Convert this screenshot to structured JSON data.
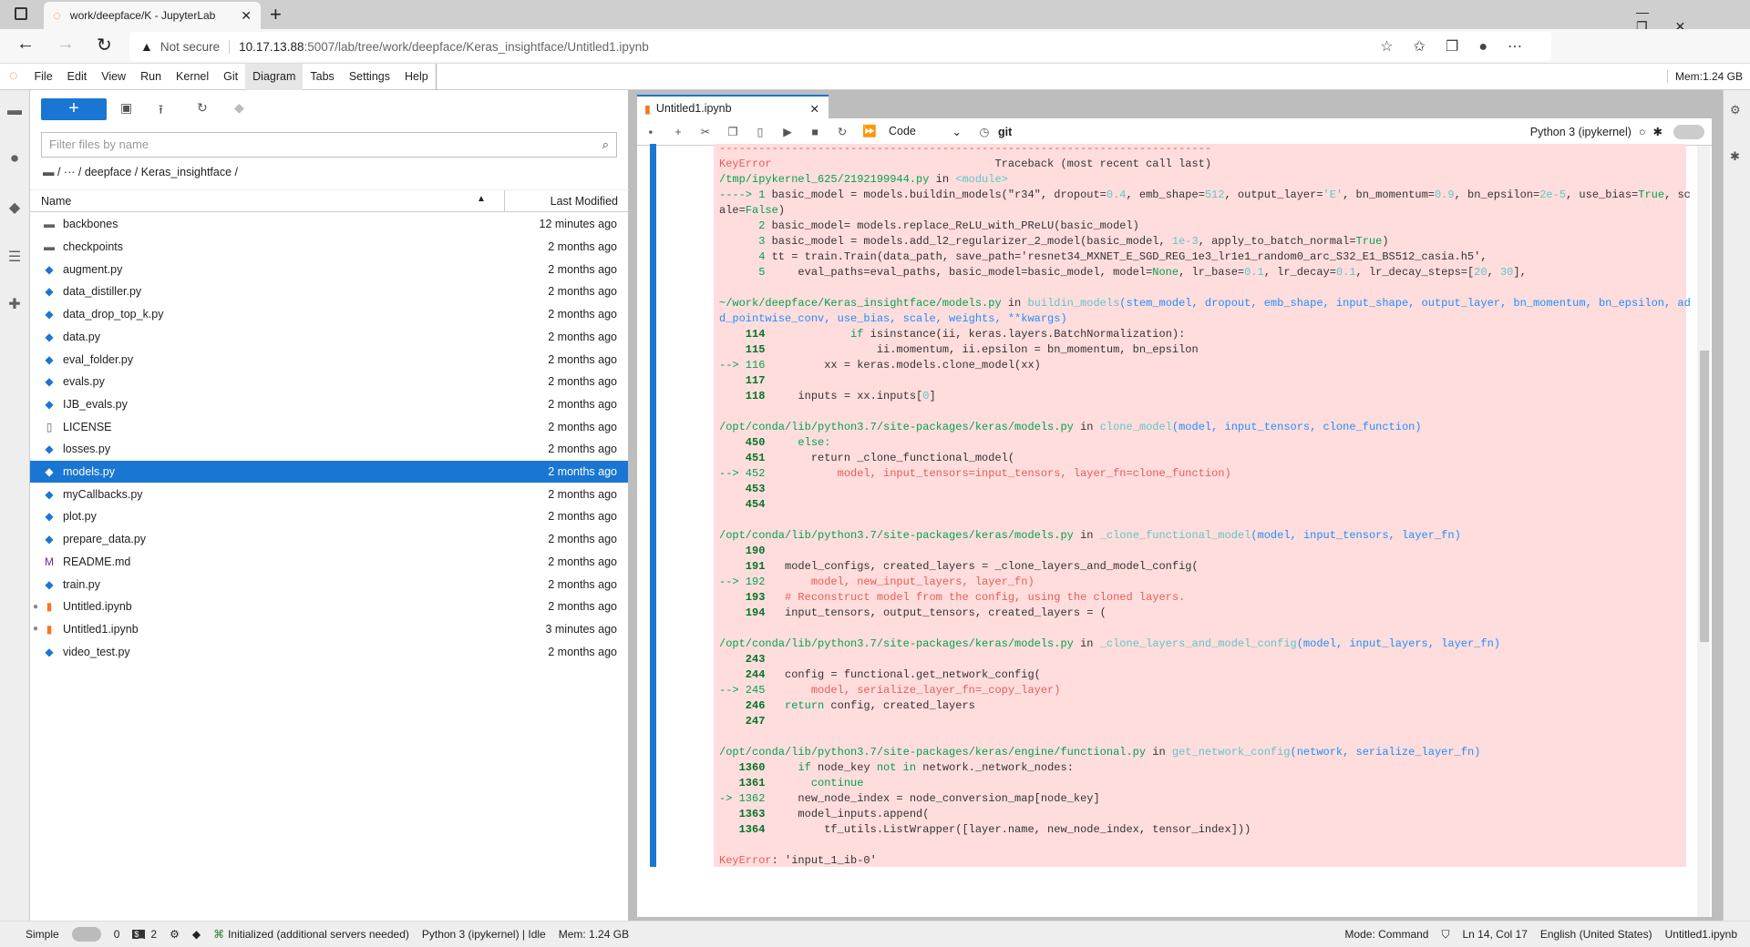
{
  "browser": {
    "tab_title": "work/deepface/K - JupyterLab",
    "security": "Not secure",
    "url_host": "10.17.13.88",
    "url_rest": ":5007/lab/tree/work/deepface/Keras_insightface/Untitled1.ipynb"
  },
  "menu": [
    "File",
    "Edit",
    "View",
    "Run",
    "Kernel",
    "Git",
    "Diagram",
    "Tabs",
    "Settings",
    "Help"
  ],
  "mem_top": "Mem:1.24 GB",
  "filebrowser": {
    "filter_placeholder": "Filter files by name",
    "breadcrumb": "/   ···   /  deepface  /  Keras_insightface  /",
    "col_name": "Name",
    "col_modified": "Last Modified",
    "files": [
      {
        "name": "backbones",
        "type": "folder",
        "modified": "12 minutes ago"
      },
      {
        "name": "checkpoints",
        "type": "folder",
        "modified": "2 months ago"
      },
      {
        "name": "augment.py",
        "type": "py",
        "modified": "2 months ago"
      },
      {
        "name": "data_distiller.py",
        "type": "py",
        "modified": "2 months ago"
      },
      {
        "name": "data_drop_top_k.py",
        "type": "py",
        "modified": "2 months ago"
      },
      {
        "name": "data.py",
        "type": "py",
        "modified": "2 months ago"
      },
      {
        "name": "eval_folder.py",
        "type": "py",
        "modified": "2 months ago"
      },
      {
        "name": "evals.py",
        "type": "py",
        "modified": "2 months ago"
      },
      {
        "name": "IJB_evals.py",
        "type": "py",
        "modified": "2 months ago"
      },
      {
        "name": "LICENSE",
        "type": "file",
        "modified": "2 months ago"
      },
      {
        "name": "losses.py",
        "type": "py",
        "modified": "2 months ago"
      },
      {
        "name": "models.py",
        "type": "py",
        "modified": "2 months ago",
        "selected": true
      },
      {
        "name": "myCallbacks.py",
        "type": "py",
        "modified": "2 months ago"
      },
      {
        "name": "plot.py",
        "type": "py",
        "modified": "2 months ago"
      },
      {
        "name": "prepare_data.py",
        "type": "py",
        "modified": "2 months ago"
      },
      {
        "name": "README.md",
        "type": "md",
        "modified": "2 months ago"
      },
      {
        "name": "train.py",
        "type": "py",
        "modified": "2 months ago"
      },
      {
        "name": "Untitled.ipynb",
        "type": "nb",
        "modified": "2 months ago",
        "running": true
      },
      {
        "name": "Untitled1.ipynb",
        "type": "nb",
        "modified": "3 minutes ago",
        "running": true
      },
      {
        "name": "video_test.py",
        "type": "py",
        "modified": "2 months ago"
      }
    ]
  },
  "notebook": {
    "tab_title": "Untitled1.ipynb",
    "cell_type": "Code",
    "git_label": "git",
    "kernel": "Python 3 (ipykernel)",
    "output": [
      [
        [
          "r",
          "---------------------------------------------------------------------------"
        ]
      ],
      [
        [
          "r",
          "KeyError"
        ],
        [
          "k",
          "                                  Traceback (most recent call last)"
        ]
      ],
      [
        [
          "g",
          "/tmp/ipykernel_625/2192199944.py"
        ],
        [
          "k",
          " in "
        ],
        [
          "c",
          "<module>"
        ]
      ],
      [
        [
          "g",
          "----> 1 "
        ],
        [
          "k",
          "basic_model = models.buildin_models(\"r34\", dropout="
        ],
        [
          "c",
          "0.4"
        ],
        [
          "k",
          ", emb_shape="
        ],
        [
          "c",
          "512"
        ],
        [
          "k",
          ", output_layer="
        ],
        [
          "c",
          "'E'"
        ],
        [
          "k",
          ", bn_momentum="
        ],
        [
          "c",
          "0.9"
        ],
        [
          "k",
          ", bn_epsilon="
        ],
        [
          "c",
          "2e-5"
        ],
        [
          "k",
          ", use_bias="
        ],
        [
          "g",
          "True"
        ],
        [
          "k",
          ", sc"
        ]
      ],
      [
        [
          "k",
          "ale="
        ],
        [
          "g",
          "False"
        ],
        [
          "k",
          ")"
        ]
      ],
      [
        [
          "g",
          "      2 "
        ],
        [
          "k",
          "basic_model= models.replace_ReLU_with_PReLU(basic_model)"
        ]
      ],
      [
        [
          "g",
          "      3 "
        ],
        [
          "k",
          "basic_model = models.add_l2_regularizer_2_model(basic_model, "
        ],
        [
          "c",
          "1e-3"
        ],
        [
          "k",
          ", apply_to_batch_normal="
        ],
        [
          "g",
          "True"
        ],
        [
          "k",
          ")"
        ]
      ],
      [
        [
          "g",
          "      4 "
        ],
        [
          "k",
          "tt = train.Train(data_path, save_path='resnet34_MXNET_E_SGD_REG_1e3_lr1e1_random0_arc_S32_E1_BS512_casia.h5',"
        ]
      ],
      [
        [
          "g",
          "      5 "
        ],
        [
          "k",
          "    eval_paths=eval_paths, basic_model=basic_model, model="
        ],
        [
          "g",
          "None"
        ],
        [
          "k",
          ", lr_base="
        ],
        [
          "c",
          "0.1"
        ],
        [
          "k",
          ", lr_decay="
        ],
        [
          "c",
          "0.1"
        ],
        [
          "k",
          ", lr_decay_steps=["
        ],
        [
          "c",
          "20"
        ],
        [
          "k",
          ", "
        ],
        [
          "c",
          "30"
        ],
        [
          "k",
          "],"
        ]
      ],
      [],
      [
        [
          "g",
          "~/work/deepface/Keras_insightface/models.py"
        ],
        [
          "k",
          " in "
        ],
        [
          "c",
          "buildin_models"
        ],
        [
          "b",
          "(stem_model, dropout, emb_shape, input_shape, output_layer, bn_momentum, bn_epsilon, ad"
        ]
      ],
      [
        [
          "b",
          "d_pointwise_conv, use_bias, scale, weights, **kwargs)"
        ]
      ],
      [
        [
          "n",
          "    114 "
        ],
        [
          "g",
          "            if "
        ],
        [
          "k",
          "isinstance(ii, keras.layers.BatchNormalization):"
        ]
      ],
      [
        [
          "n",
          "    115 "
        ],
        [
          "k",
          "                ii.momentum, ii.epsilon = bn_momentum, bn_epsilon"
        ]
      ],
      [
        [
          "g",
          "--> 116 "
        ],
        [
          "k",
          "        xx = keras.models.clone_model(xx)"
        ]
      ],
      [
        [
          "n",
          "    117 "
        ]
      ],
      [
        [
          "n",
          "    118 "
        ],
        [
          "k",
          "    inputs = xx.inputs["
        ],
        [
          "c",
          "0"
        ],
        [
          "k",
          "]"
        ]
      ],
      [],
      [
        [
          "g",
          "/opt/conda/lib/python3.7/site-packages/keras/models.py"
        ],
        [
          "k",
          " in "
        ],
        [
          "c",
          "clone_model"
        ],
        [
          "b",
          "(model, input_tensors, clone_function)"
        ]
      ],
      [
        [
          "n",
          "    450 "
        ],
        [
          "g",
          "    else:"
        ]
      ],
      [
        [
          "n",
          "    451 "
        ],
        [
          "k",
          "      return _clone_functional_model("
        ]
      ],
      [
        [
          "g",
          "--> 452 "
        ],
        [
          "r",
          "          model, input_tensors=input_tensors, layer_fn=clone_function)"
        ]
      ],
      [
        [
          "n",
          "    453 "
        ]
      ],
      [
        [
          "n",
          "    454 "
        ]
      ],
      [],
      [
        [
          "g",
          "/opt/conda/lib/python3.7/site-packages/keras/models.py"
        ],
        [
          "k",
          " in "
        ],
        [
          "c",
          "_clone_functional_model"
        ],
        [
          "b",
          "(model, input_tensors, layer_fn)"
        ]
      ],
      [
        [
          "n",
          "    190 "
        ]
      ],
      [
        [
          "n",
          "    191 "
        ],
        [
          "k",
          "  model_configs, created_layers = _clone_layers_and_model_config("
        ]
      ],
      [
        [
          "g",
          "--> 192 "
        ],
        [
          "r",
          "      model, new_input_layers, layer_fn)"
        ]
      ],
      [
        [
          "n",
          "    193 "
        ],
        [
          "r",
          "  # Reconstruct model from the config, using the cloned layers."
        ]
      ],
      [
        [
          "n",
          "    194 "
        ],
        [
          "k",
          "  input_tensors, output_tensors, created_layers = ("
        ]
      ],
      [],
      [
        [
          "g",
          "/opt/conda/lib/python3.7/site-packages/keras/models.py"
        ],
        [
          "k",
          " in "
        ],
        [
          "c",
          "_clone_layers_and_model_config"
        ],
        [
          "b",
          "(model, input_layers, layer_fn)"
        ]
      ],
      [
        [
          "n",
          "    243 "
        ]
      ],
      [
        [
          "n",
          "    244 "
        ],
        [
          "k",
          "  config = functional.get_network_config("
        ]
      ],
      [
        [
          "g",
          "--> 245 "
        ],
        [
          "r",
          "      model, serialize_layer_fn=_copy_layer)"
        ]
      ],
      [
        [
          "n",
          "    246 "
        ],
        [
          "g",
          "  return "
        ],
        [
          "k",
          "config, created_layers"
        ]
      ],
      [
        [
          "n",
          "    247 "
        ]
      ],
      [],
      [
        [
          "g",
          "/opt/conda/lib/python3.7/site-packages/keras/engine/functional.py"
        ],
        [
          "k",
          " in "
        ],
        [
          "c",
          "get_network_config"
        ],
        [
          "b",
          "(network, serialize_layer_fn)"
        ]
      ],
      [
        [
          "n",
          "   1360 "
        ],
        [
          "g",
          "    if "
        ],
        [
          "k",
          "node_key "
        ],
        [
          "g",
          "not in "
        ],
        [
          "k",
          "network._network_nodes:"
        ]
      ],
      [
        [
          "n",
          "   1361 "
        ],
        [
          "g",
          "      continue"
        ]
      ],
      [
        [
          "g",
          "-> 1362 "
        ],
        [
          "k",
          "    new_node_index = node_conversion_map[node_key]"
        ]
      ],
      [
        [
          "n",
          "   1363 "
        ],
        [
          "k",
          "    model_inputs.append("
        ]
      ],
      [
        [
          "n",
          "   1364 "
        ],
        [
          "k",
          "        tf_utils.ListWrapper([layer.name, new_node_index, tensor_index]))"
        ]
      ],
      [],
      [
        [
          "r",
          "KeyError"
        ],
        [
          "k",
          ": 'input_1_ib-0'"
        ]
      ]
    ]
  },
  "status": {
    "mode_toggle": "Simple",
    "terminals": "0",
    "kernels": "2",
    "lsp": "Initialized (additional servers needed)",
    "kernel_status": "Python 3 (ipykernel) | Idle",
    "mem": "Mem: 1.24 GB",
    "mode": "Mode: Command",
    "cursor": "Ln 14, Col 17",
    "language": "English (United States)",
    "file": "Untitled1.ipynb"
  },
  "colors": {
    "accent": "#1976d2",
    "error_bg": "#ffdddd"
  }
}
